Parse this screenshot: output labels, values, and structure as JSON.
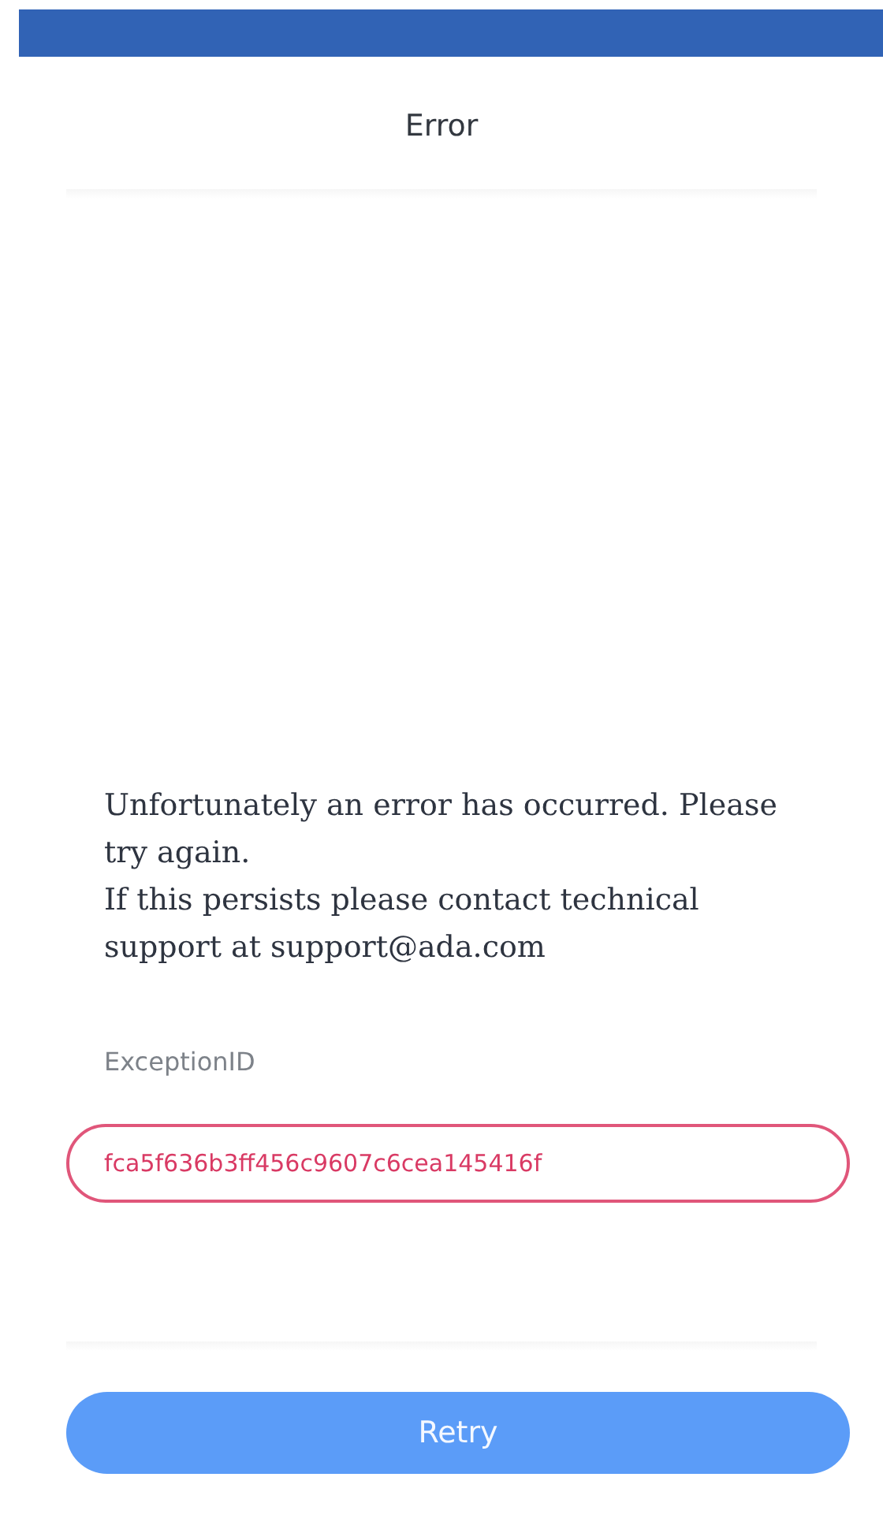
{
  "header": {
    "title": "Error"
  },
  "message": "Unfortunately an error has occurred. Please try again.\nIf this persists please contact technical support at support@ada.com",
  "exception": {
    "label": "ExceptionID",
    "value": "fca5f636b3ff456c9607c6cea145416f"
  },
  "buttons": [
    "Retry"
  ]
}
